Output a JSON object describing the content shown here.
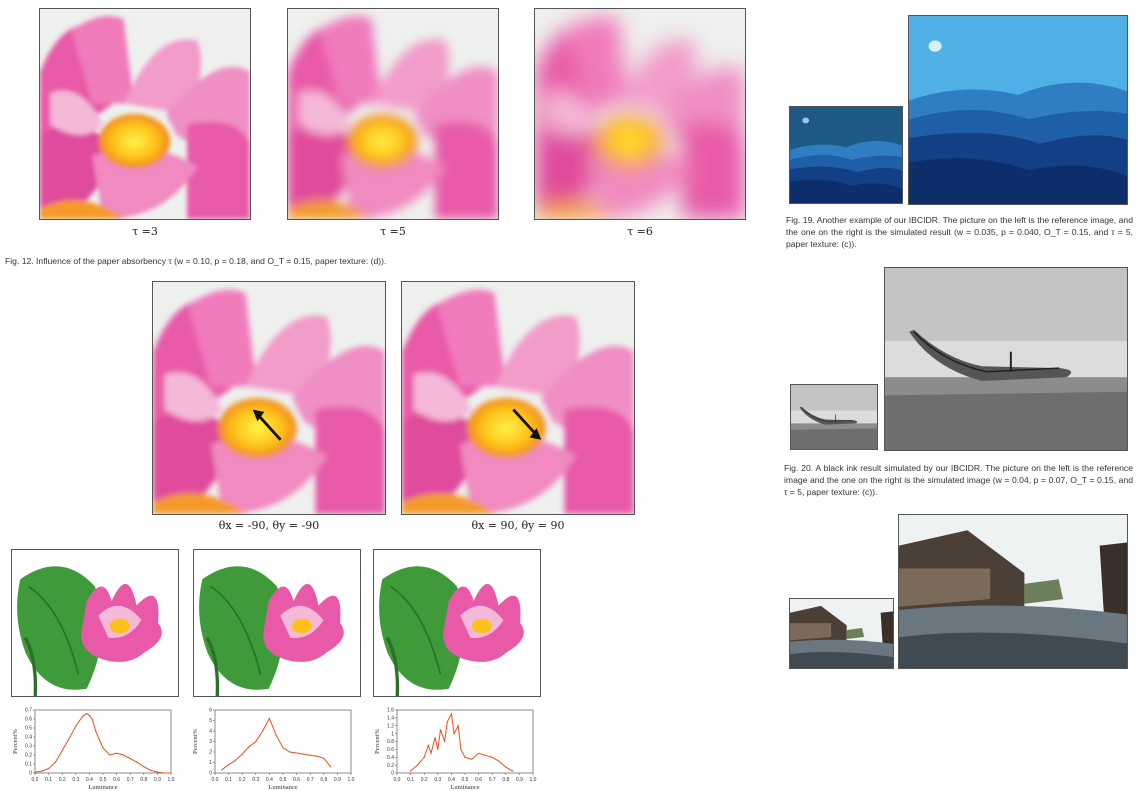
{
  "fig12": {
    "panels": [
      {
        "label": "τ =3",
        "blur": 1.2
      },
      {
        "label": "τ =5",
        "blur": 2.4
      },
      {
        "label": "τ =6",
        "blur": 5
      }
    ],
    "caption": "Fig. 12. Influence of the paper absorbency τ (w = 0.10, p = 0.18, and O_T = 0.15, paper texture: (d))."
  },
  "direction_panels": [
    {
      "label": "θx = -90, θy = -90",
      "arrow": "up-left"
    },
    {
      "label": "θx = 90, θy = 90",
      "arrow": "down-right"
    }
  ],
  "histograms": [
    {
      "ylabel": "Percent%",
      "xlabel": "Luminance",
      "yticks": [
        "0",
        "0.1",
        "0.2",
        "0.3",
        "0.4",
        "0.5",
        "0.6",
        "0.7"
      ],
      "xticks": [
        "0.0",
        "0.1",
        "0.2",
        "0.3",
        "0.4",
        "0.5",
        "0.6",
        "0.7",
        "0.8",
        "0.9",
        "1.0"
      ],
      "ymax": 0.7,
      "x": [
        0.0,
        0.05,
        0.1,
        0.15,
        0.2,
        0.25,
        0.3,
        0.35,
        0.38,
        0.4,
        0.42,
        0.45,
        0.5,
        0.55,
        0.6,
        0.65,
        0.7,
        0.75,
        0.8,
        0.85,
        0.9,
        0.95,
        1.0
      ],
      "y": [
        0.01,
        0.02,
        0.05,
        0.12,
        0.25,
        0.38,
        0.52,
        0.63,
        0.66,
        0.64,
        0.6,
        0.45,
        0.28,
        0.2,
        0.22,
        0.2,
        0.16,
        0.12,
        0.07,
        0.03,
        0.01,
        0.0,
        0.0
      ]
    },
    {
      "ylabel": "Percent%",
      "xlabel": "Luminance",
      "yticks": [
        "0",
        "1",
        "2",
        "3",
        "4",
        "5",
        "6"
      ],
      "xticks": [
        "0.0",
        "0.1",
        "0.2",
        "0.3",
        "0.4",
        "0.5",
        "0.6",
        "0.7",
        "0.8",
        "0.9",
        "1.0"
      ],
      "ymax": 6,
      "x": [
        0.05,
        0.1,
        0.15,
        0.2,
        0.25,
        0.3,
        0.35,
        0.4,
        0.45,
        0.5,
        0.55,
        0.6,
        0.65,
        0.7,
        0.75,
        0.8,
        0.85
      ],
      "y": [
        0.3,
        0.8,
        1.2,
        1.8,
        2.5,
        3.0,
        4.0,
        5.2,
        3.6,
        2.4,
        2.0,
        1.9,
        1.8,
        1.7,
        1.6,
        1.4,
        0.6
      ]
    },
    {
      "ylabel": "Percent%",
      "xlabel": "Luminance",
      "yticks": [
        "0",
        "0.2",
        "0.4",
        "0.6",
        "0.8",
        "1",
        "1.2",
        "1.4",
        "1.6"
      ],
      "xticks": [
        "0.0",
        "0.1",
        "0.2",
        "0.3",
        "0.4",
        "0.5",
        "0.6",
        "0.7",
        "0.8",
        "0.9",
        "1.0"
      ],
      "ymax": 1.6,
      "x": [
        0.1,
        0.15,
        0.2,
        0.23,
        0.25,
        0.28,
        0.3,
        0.32,
        0.35,
        0.37,
        0.4,
        0.42,
        0.45,
        0.47,
        0.5,
        0.55,
        0.6,
        0.65,
        0.7,
        0.75,
        0.8,
        0.85
      ],
      "y": [
        0.05,
        0.2,
        0.4,
        0.7,
        0.5,
        0.9,
        0.6,
        1.1,
        0.8,
        1.3,
        1.5,
        1.0,
        1.2,
        0.6,
        0.4,
        0.35,
        0.5,
        0.45,
        0.4,
        0.3,
        0.15,
        0.05
      ]
    }
  ],
  "fig19": {
    "caption": "Fig. 19. Another example of our IBCIDR. The picture on the left is the reference image, and the one on the right is the simulated result (w = 0.035, p = 0.040, O_T = 0.15, and τ = 5, paper texture: (c))."
  },
  "fig20": {
    "caption": "Fig. 20. A black ink result simulated by our IBCIDR. The picture on the left is the reference image and the one on the right is the simulated image (w = 0.04, p = 0.07, O_T = 0.15, and τ = 5, paper texture: (c))."
  },
  "colors": {
    "petal": "#e85aa8",
    "petal_light": "#f4b8d8",
    "center": "#ffc21a",
    "leaf": "#3f9a3a",
    "hist_line": "#e8501c",
    "sea_dark": "#0d2e6a",
    "sea_light": "#4fb0e6"
  }
}
